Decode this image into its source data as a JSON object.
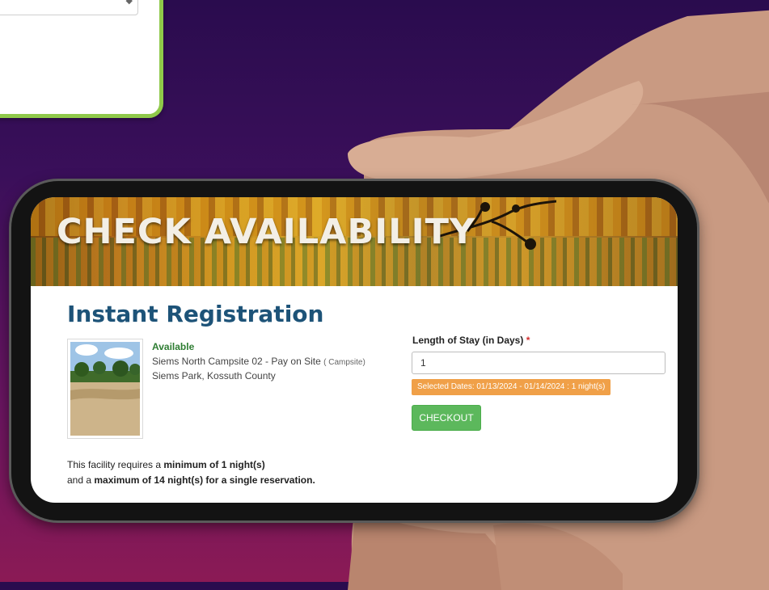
{
  "banner": {
    "title": "CHECK AVAILABILITY"
  },
  "registration": {
    "title": "Instant Registration",
    "status": "Available",
    "site_name": "Siems North Campsite 02 - Pay on Site",
    "site_type": "( Campsite)",
    "park": "Siems Park, Kossuth County"
  },
  "stay": {
    "label": "Length of Stay (in Days)",
    "required_mark": "*",
    "value": "1",
    "selected_dates": "Selected Dates: 01/13/2024 - 01/14/2024 : 1 night(s)"
  },
  "checkout_label": "CHECKOUT",
  "policy": {
    "line1_prefix": "This facility requires a ",
    "line1_bold": "minimum of 1 night(s)",
    "line2_prefix": "and a ",
    "line2_bold": "maximum of 14 night(s) for a single reservation."
  },
  "colors": {
    "heading_blue": "#1d5378",
    "available_green": "#2e7d32",
    "checkout_green": "#5cb85c",
    "dates_orange": "#f0a048",
    "card_border_green": "#8fc94a"
  },
  "icons": {
    "select_chevron": "chevron-down-icon"
  }
}
